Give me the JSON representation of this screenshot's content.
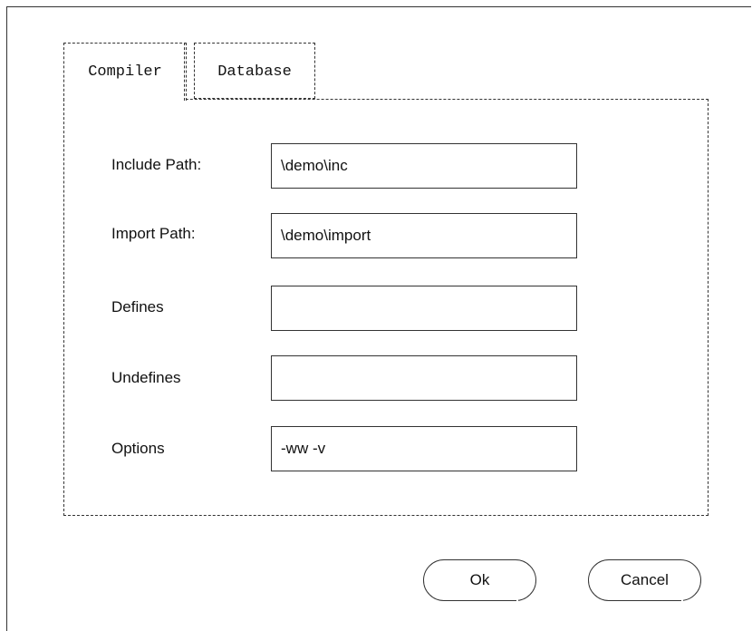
{
  "tabs": [
    {
      "label": "Compiler",
      "active": true
    },
    {
      "label": "Database",
      "active": false
    }
  ],
  "fields": [
    {
      "label": "Include Path:",
      "value": "\\demo\\inc"
    },
    {
      "label": "Import Path:",
      "value": "\\demo\\import"
    },
    {
      "label": "Defines",
      "value": ""
    },
    {
      "label": "Undefines",
      "value": ""
    },
    {
      "label": "Options",
      "value": "-ww -v"
    }
  ],
  "buttons": {
    "ok_label": "Ok",
    "cancel_label": "Cancel"
  },
  "colors": {
    "border": "#333333",
    "background": "#ffffff",
    "text": "#111111"
  }
}
